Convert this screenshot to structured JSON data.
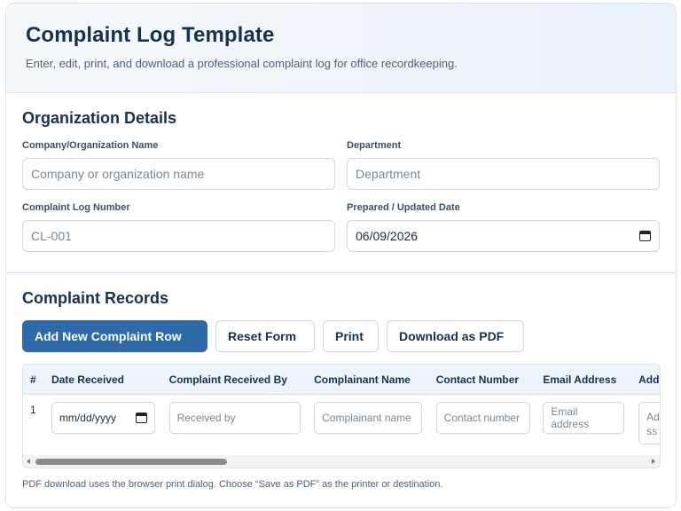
{
  "header": {
    "title": "Complaint Log Template",
    "subtitle": "Enter, edit, print, and download a professional complaint log for office recordkeeping."
  },
  "organization": {
    "heading": "Organization Details",
    "company": {
      "label": "Company/Organization Name",
      "placeholder": "Company or organization name"
    },
    "department": {
      "label": "Department",
      "placeholder": "Department"
    },
    "log_number": {
      "label": "Complaint Log Number",
      "value": "CL-001"
    },
    "date": {
      "label": "Prepared / Updated Date",
      "value": "06/09/2026"
    }
  },
  "records": {
    "heading": "Complaint Records",
    "buttons": {
      "add": "Add New Complaint Row",
      "reset": "Reset Form",
      "print": "Print",
      "download": "Download as PDF"
    },
    "columns": [
      "#",
      "Date Received",
      "Complaint Received By",
      "Complainant Name",
      "Contact Number",
      "Email Address",
      "Add"
    ],
    "row": {
      "number": "1",
      "date_placeholder": "mm/dd/yyyy",
      "received_by_placeholder": "Received by",
      "complainant_placeholder": "Complainant name",
      "contact_placeholder": "Contact number",
      "email_placeholder": "Email address",
      "address_placeholder": "Ad ss"
    },
    "note": "PDF download uses the browser print dialog. Choose “Save as PDF” as the printer or destination."
  },
  "icons": [
    "calendar-icon",
    "scroll-left-arrow-icon",
    "scroll-right-arrow-icon"
  ],
  "colors": {
    "primary": "#2f6aa8",
    "heading": "#17314f"
  }
}
